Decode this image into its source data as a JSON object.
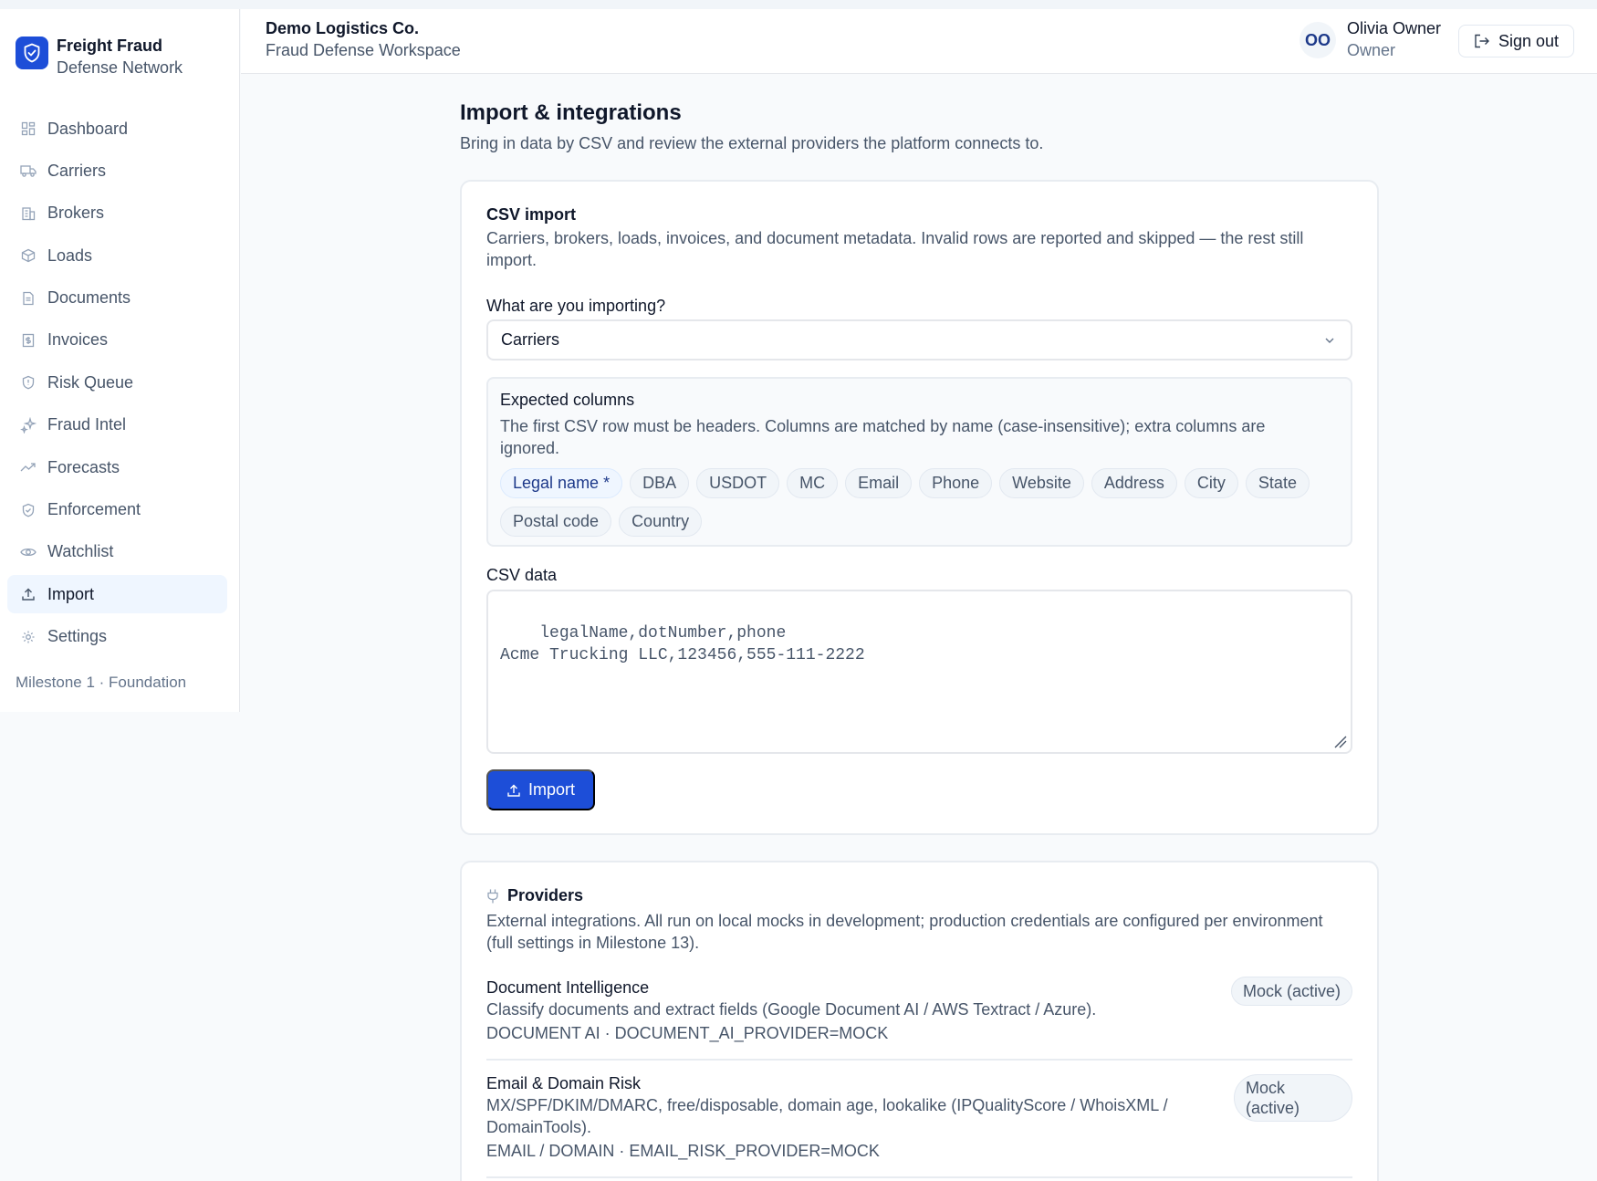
{
  "brand": {
    "name": "Freight Fraud",
    "sub": "Defense Network"
  },
  "sidebar": {
    "items": [
      {
        "label": "Dashboard",
        "icon": "dashboard-icon",
        "active": false
      },
      {
        "label": "Carriers",
        "icon": "truck-icon",
        "active": false
      },
      {
        "label": "Brokers",
        "icon": "building-icon",
        "active": false
      },
      {
        "label": "Loads",
        "icon": "package-icon",
        "active": false
      },
      {
        "label": "Documents",
        "icon": "document-icon",
        "active": false
      },
      {
        "label": "Invoices",
        "icon": "receipt-icon",
        "active": false
      },
      {
        "label": "Risk Queue",
        "icon": "shield-alert-icon",
        "active": false
      },
      {
        "label": "Fraud Intel",
        "icon": "sparkle-icon",
        "active": false
      },
      {
        "label": "Forecasts",
        "icon": "trend-icon",
        "active": false
      },
      {
        "label": "Enforcement",
        "icon": "shield-check-icon",
        "active": false
      },
      {
        "label": "Watchlist",
        "icon": "eye-icon",
        "active": false
      },
      {
        "label": "Import",
        "icon": "upload-icon",
        "active": true
      },
      {
        "label": "Settings",
        "icon": "gear-icon",
        "active": false
      }
    ],
    "milestone": "Milestone 1 · Foundation"
  },
  "header": {
    "org_name": "Demo Logistics Co.",
    "org_sub": "Fraud Defense Workspace",
    "avatar_initials": "OO",
    "user_name": "Olivia Owner",
    "user_role": "Owner",
    "signout_label": "Sign out"
  },
  "page": {
    "title": "Import & integrations",
    "subtitle": "Bring in data by CSV and review the external providers the platform connects to."
  },
  "csv_import": {
    "title": "CSV import",
    "description": "Carriers, brokers, loads, invoices, and document metadata. Invalid rows are reported and skipped — the rest still import.",
    "select_label": "What are you importing?",
    "select_value": "Carriers",
    "expected": {
      "title": "Expected columns",
      "description": "The first CSV row must be headers. Columns are matched by name (case-insensitive); extra columns are ignored.",
      "columns": [
        {
          "label": "Legal name *",
          "required": true
        },
        {
          "label": "DBA",
          "required": false
        },
        {
          "label": "USDOT",
          "required": false
        },
        {
          "label": "MC",
          "required": false
        },
        {
          "label": "Email",
          "required": false
        },
        {
          "label": "Phone",
          "required": false
        },
        {
          "label": "Website",
          "required": false
        },
        {
          "label": "Address",
          "required": false
        },
        {
          "label": "City",
          "required": false
        },
        {
          "label": "State",
          "required": false
        },
        {
          "label": "Postal code",
          "required": false
        },
        {
          "label": "Country",
          "required": false
        }
      ]
    },
    "data_label": "CSV data",
    "data_placeholder": "legalName,dotNumber,phone\nAcme Trucking LLC,123456,555-111-2222",
    "import_label": "Import"
  },
  "providers": {
    "title": "Providers",
    "description": "External integrations. All run on local mocks in development; production credentials are configured per environment (full settings in Milestone 13).",
    "items": [
      {
        "name": "Document Intelligence",
        "description": "Classify documents and extract fields (Google Document AI / AWS Textract / Azure).",
        "code": "DOCUMENT AI · DOCUMENT_AI_PROVIDER=MOCK",
        "status": "Mock (active)"
      },
      {
        "name": "Email & Domain Risk",
        "description": "MX/SPF/DKIM/DMARC, free/disposable, domain age, lookalike (IPQualityScore / WhoisXML / DomainTools).",
        "code": "EMAIL / DOMAIN · EMAIL_RISK_PROVIDER=MOCK",
        "status": "Mock (active)"
      }
    ]
  },
  "colors": {
    "accent": "#1d4ed8",
    "active_nav_bg": "#eff6ff"
  }
}
